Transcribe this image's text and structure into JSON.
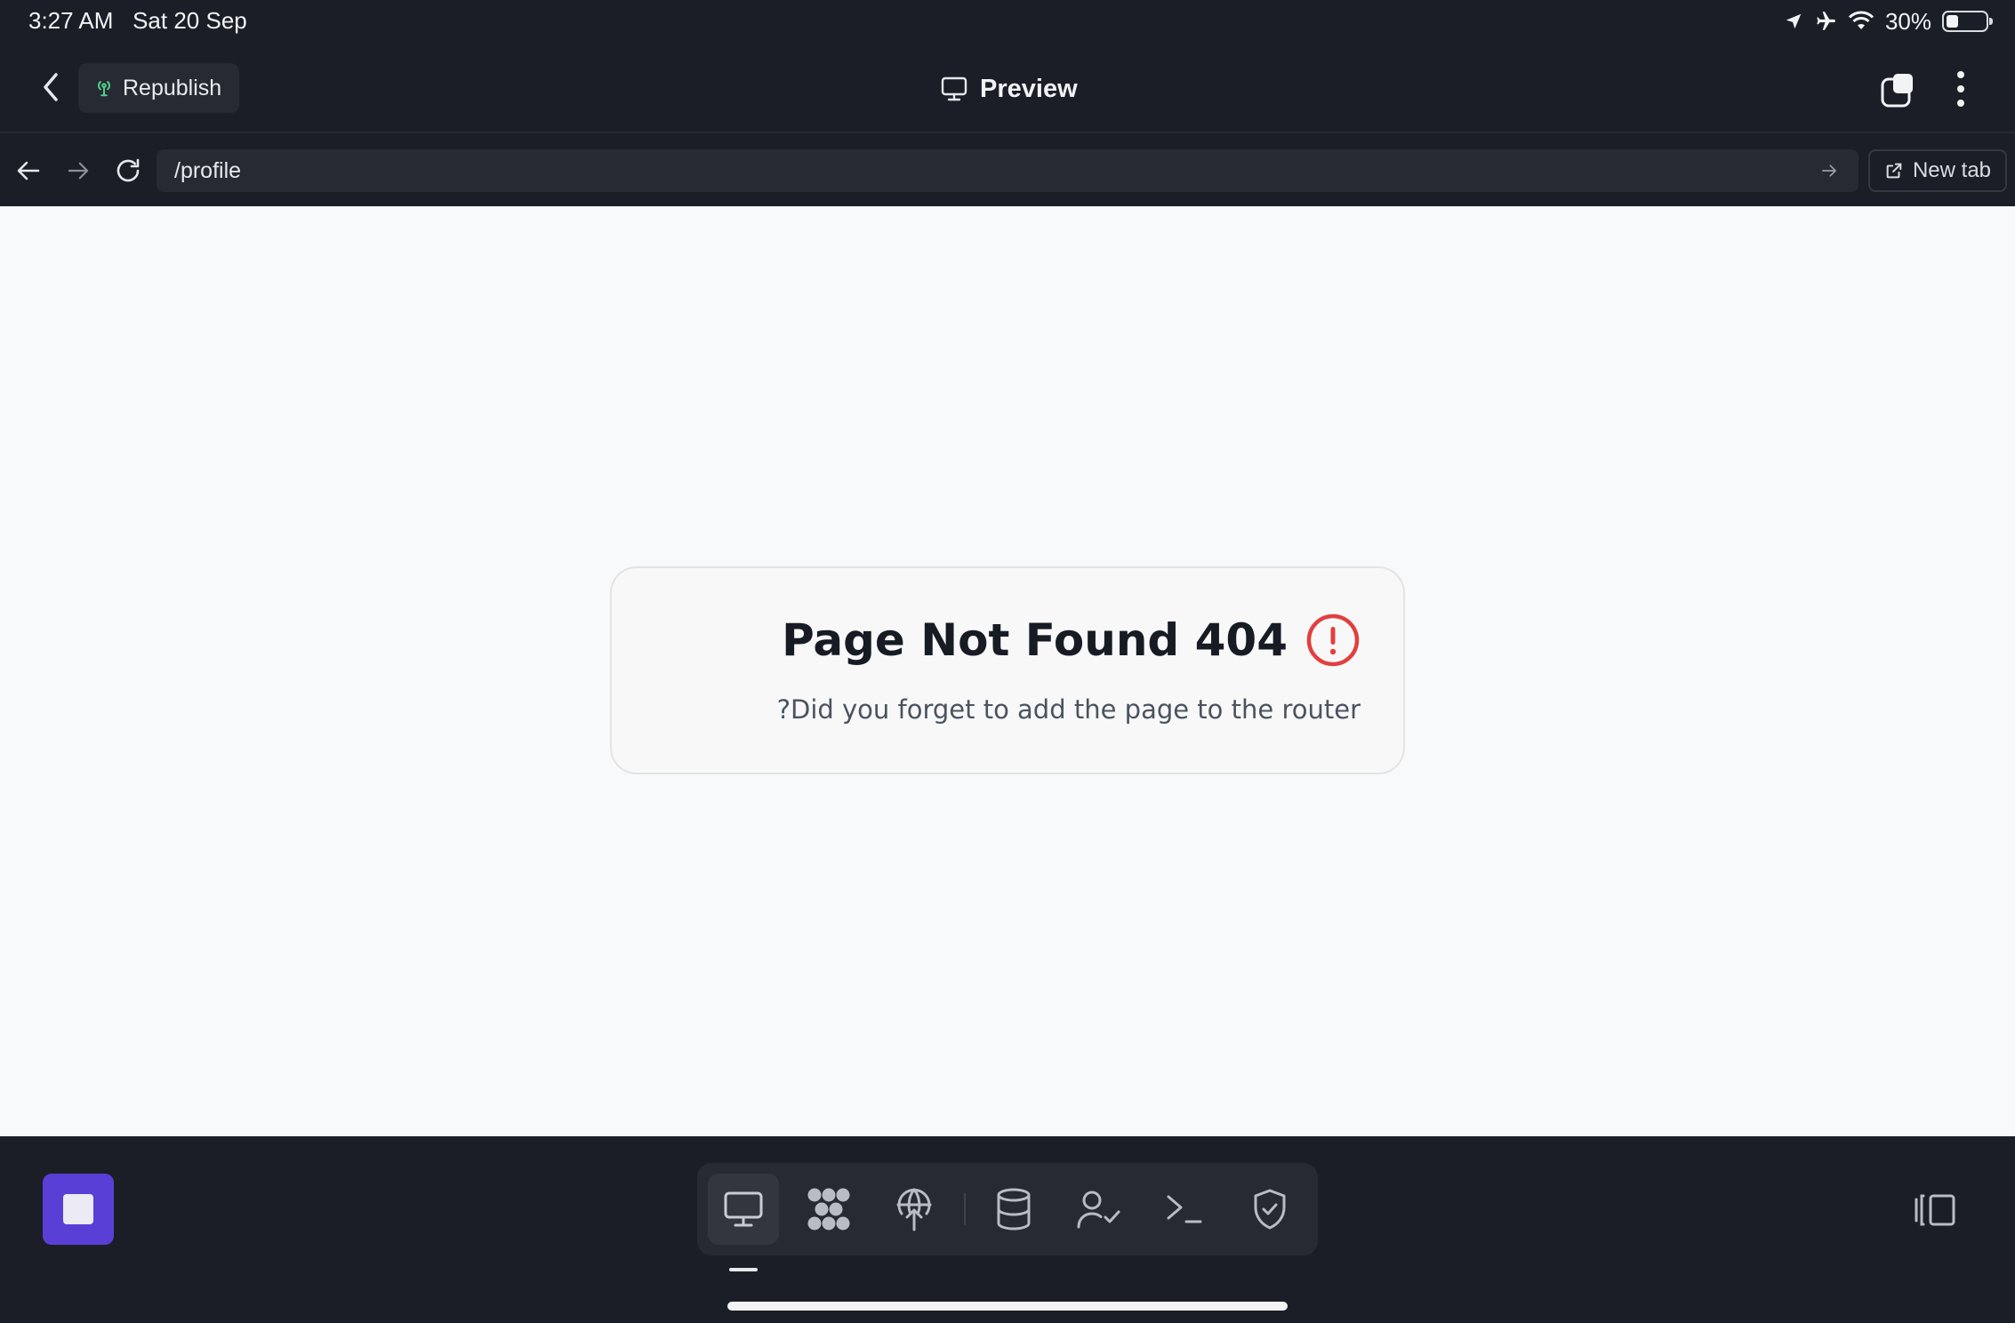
{
  "status_bar": {
    "time": "3:27 AM",
    "date": "Sat 20 Sep",
    "battery_label": "30%",
    "battery_level": 0.3
  },
  "header": {
    "back_icon": "chevron-left-icon",
    "republish_label": "Republish",
    "republish_icon": "broadcast-antenna-icon",
    "title": "Preview",
    "title_icon": "monitor-icon",
    "tabs_icon": "stacked-squares-icon",
    "more_icon": "vertical-dots-icon"
  },
  "navbar": {
    "url": "/profile",
    "new_tab_label": "New tab"
  },
  "page": {
    "heading": "Page Not Found 404",
    "message": "?Did you forget to add the page to the router",
    "alert_color": "#e0403f"
  },
  "toolbar": {
    "tools": [
      "preview-monitor-icon",
      "integrations-icon",
      "deploy-icon",
      "database-icon",
      "auth-users-icon",
      "console-icon",
      "security-shield-icon"
    ],
    "accent": "#5a3fd6"
  }
}
